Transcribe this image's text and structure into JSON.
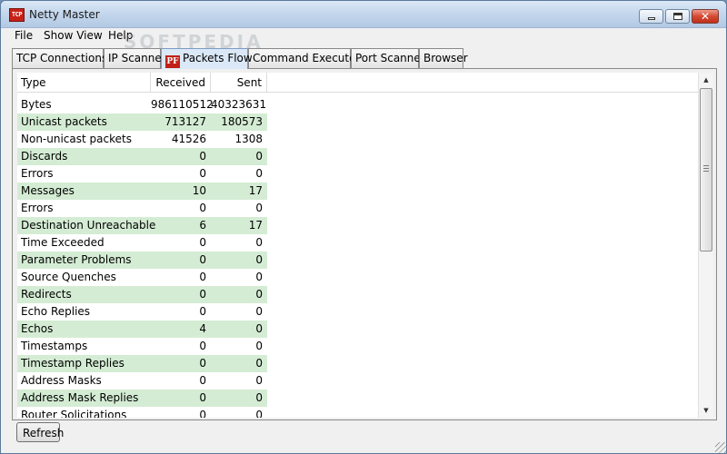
{
  "window": {
    "title": "Netty Master",
    "app_icon_text": "TCP",
    "close_glyph": "✕"
  },
  "menu": [
    "File",
    "Show View",
    "Help"
  ],
  "watermark": "SOFTPEDIA",
  "tabs": [
    {
      "label": "TCP Connections",
      "active": false
    },
    {
      "label": "IP Scanner",
      "active": false
    },
    {
      "label": "Packets Flow",
      "active": true,
      "icon_text": "PF"
    },
    {
      "label": "Command Executor",
      "active": false
    },
    {
      "label": "Port Scanner",
      "active": false
    },
    {
      "label": "Browser",
      "active": false
    }
  ],
  "table": {
    "columns": [
      "Type",
      "Received",
      "Sent"
    ],
    "rows": [
      {
        "type": "Bytes",
        "received": "986110512",
        "sent": "40323631"
      },
      {
        "type": "Unicast packets",
        "received": "713127",
        "sent": "180573"
      },
      {
        "type": "Non-unicast packets",
        "received": "41526",
        "sent": "1308"
      },
      {
        "type": "Discards",
        "received": "0",
        "sent": "0"
      },
      {
        "type": "Errors",
        "received": "0",
        "sent": "0"
      },
      {
        "type": "Messages",
        "received": "10",
        "sent": "17"
      },
      {
        "type": "Errors",
        "received": "0",
        "sent": "0"
      },
      {
        "type": "Destination Unreachable",
        "received": "6",
        "sent": "17"
      },
      {
        "type": "Time Exceeded",
        "received": "0",
        "sent": "0"
      },
      {
        "type": "Parameter Problems",
        "received": "0",
        "sent": "0"
      },
      {
        "type": "Source Quenches",
        "received": "0",
        "sent": "0"
      },
      {
        "type": "Redirects",
        "received": "0",
        "sent": "0"
      },
      {
        "type": "Echo Replies",
        "received": "0",
        "sent": "0"
      },
      {
        "type": "Echos",
        "received": "4",
        "sent": "0"
      },
      {
        "type": "Timestamps",
        "received": "0",
        "sent": "0"
      },
      {
        "type": "Timestamp Replies",
        "received": "0",
        "sent": "0"
      },
      {
        "type": "Address Masks",
        "received": "0",
        "sent": "0"
      },
      {
        "type": "Address Mask Replies",
        "received": "0",
        "sent": "0"
      },
      {
        "type": "Router Solicitations",
        "received": "0",
        "sent": "0"
      }
    ],
    "alt_row_color": "#d4ecd4"
  },
  "buttons": {
    "refresh": "Refresh"
  },
  "icons": {
    "app": "tcp-icon",
    "tab": "packets-flow-icon"
  }
}
